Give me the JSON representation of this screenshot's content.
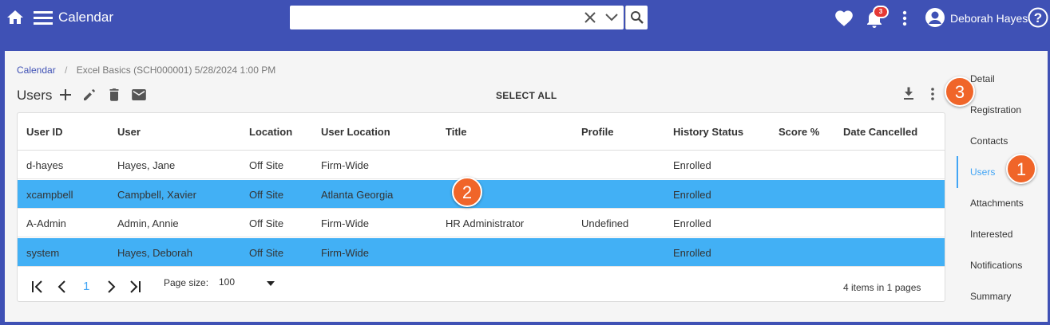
{
  "header": {
    "app_title": "Calendar",
    "notification_count": "3",
    "user_name": "Deborah Hayes",
    "search": {
      "value": "",
      "placeholder": ""
    }
  },
  "breadcrumb": {
    "root": "Calendar",
    "separator": "/",
    "current": "Excel Basics (SCH000001) 5/28/2024 1:00 PM"
  },
  "toolbar": {
    "title": "Users",
    "select_all": "SELECT ALL"
  },
  "table": {
    "columns": [
      "User ID",
      "User",
      "Location",
      "User Location",
      "Title",
      "Profile",
      "History Status",
      "Score %",
      "Date Cancelled"
    ],
    "rows": [
      {
        "selected": false,
        "cells": [
          "d-hayes",
          "Hayes, Jane",
          "Off Site",
          "Firm-Wide",
          "",
          "",
          "Enrolled",
          "",
          ""
        ]
      },
      {
        "selected": true,
        "cells": [
          "xcampbell",
          "Campbell, Xavier",
          "Off Site",
          "Atlanta Georgia",
          "",
          "",
          "Enrolled",
          "",
          ""
        ]
      },
      {
        "selected": false,
        "cells": [
          "A-Admin",
          "Admin, Annie",
          "Off Site",
          "Firm-Wide",
          "HR Administrator",
          "Undefined",
          "Enrolled",
          "",
          ""
        ]
      },
      {
        "selected": true,
        "cells": [
          "system",
          "Hayes, Deborah",
          "Off Site",
          "Firm-Wide",
          "",
          "",
          "Enrolled",
          "",
          ""
        ]
      }
    ]
  },
  "pager": {
    "current_page": "1",
    "page_size_label": "Page size:",
    "page_size": "100",
    "info": "4 items in 1 pages"
  },
  "sidenav": {
    "items": [
      "Detail",
      "Registration",
      "Contacts",
      "Users",
      "Attachments",
      "Interested",
      "Notifications",
      "Summary"
    ],
    "active": "Users"
  },
  "callouts": [
    "1",
    "2",
    "3"
  ],
  "colors": {
    "header_bg": "#3f51b5",
    "selected_row": "#42b0f5",
    "accent": "#42a5f5",
    "callout": "#f06529",
    "badge": "#e53935"
  }
}
